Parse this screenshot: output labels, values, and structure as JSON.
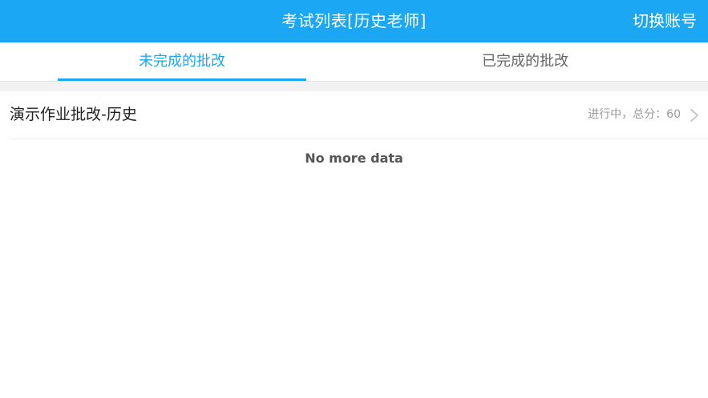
{
  "header": {
    "title": "考试列表[历史老师]",
    "switch_account_label": "切换账号"
  },
  "tabs": [
    {
      "label": "未完成的批改",
      "active": true
    },
    {
      "label": "已完成的批改",
      "active": false
    }
  ],
  "list": {
    "items": [
      {
        "title": "演示作业批改-历史",
        "status": "进行中，总分：60"
      }
    ],
    "footer": "No more data"
  },
  "colors": {
    "accent": "#1ca7f5",
    "header_text": "#ffffff",
    "inactive_tab": "#666666",
    "meta_text": "#999999"
  },
  "icons": {
    "row_chevron": "chevron-right-icon"
  }
}
